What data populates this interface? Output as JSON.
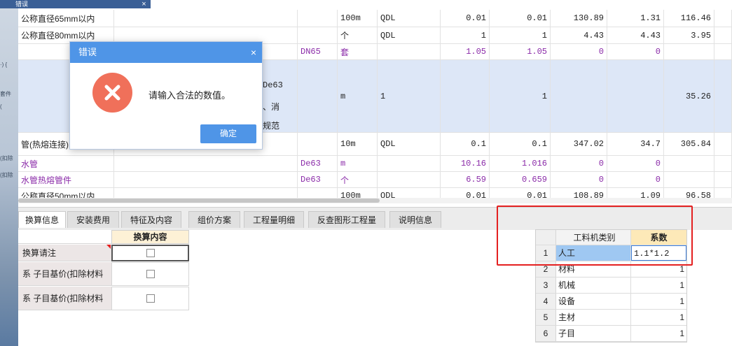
{
  "background_window": {
    "title": "错误",
    "close_glyph": "×"
  },
  "left_fragments": [
    "·) {",
    "套件",
    "( ",
    "(扣除",
    "(扣除"
  ],
  "grid_rows": [
    {
      "name": "公称直径65mm以内",
      "spec": "",
      "unit": "100m",
      "formula": "QDL",
      "qty1": "0.01",
      "qty2": "0.01",
      "p1": "130.89",
      "p2": "1.31",
      "p3": "116.46",
      "style": "normal"
    },
    {
      "name": "公称直径80mm以内",
      "spec": "",
      "unit": "个",
      "formula": "QDL",
      "qty1": "1",
      "qty2": "1",
      "p1": "4.43",
      "p2": "4.43",
      "p3": "3.95",
      "style": "normal"
    },
    {
      "name": "",
      "spec": "DN65",
      "unit": "套",
      "formula": "",
      "qty1": "1.05",
      "qty2": "1.05",
      "p1": "0",
      "p2": "0",
      "p3": "",
      "style": "purple"
    },
    {
      "name": "",
      "spec": "De63",
      "unit": "m",
      "formula": "1",
      "qty1": "",
      "qty2": "1",
      "p1": "",
      "p2": "",
      "p3": "35.26",
      "style": "selected",
      "extra1": "、消",
      "extra2": "规范"
    },
    {
      "name": "管(热熔连接) 公",
      "spec": "",
      "unit": "10m",
      "formula": "QDL",
      "qty1": "0.1",
      "qty2": "0.1",
      "p1": "347.02",
      "p2": "34.7",
      "p3": "305.84",
      "style": "normal"
    },
    {
      "name": "水管",
      "spec": "De63",
      "unit": "m",
      "formula": "",
      "qty1": "10.16",
      "qty2": "1.016",
      "p1": "0",
      "p2": "0",
      "p3": "",
      "style": "purple"
    },
    {
      "name": "水管热熔管件",
      "spec": "De63",
      "unit": "个",
      "formula": "",
      "qty1": "6.59",
      "qty2": "0.659",
      "p1": "0",
      "p2": "0",
      "p3": "",
      "style": "purple"
    },
    {
      "name": "公称直径50mm以内",
      "spec": "",
      "unit": "100m",
      "formula": "QDL",
      "qty1": "0.01",
      "qty2": "0.01",
      "p1": "108.89",
      "p2": "1.09",
      "p3": "96.58",
      "style": "normal"
    }
  ],
  "tabs": [
    "换算信息",
    "安装费用",
    "特征及内容",
    "组价方案",
    "工程量明细",
    "反查图形工程量",
    "说明信息"
  ],
  "conversion_panel": {
    "header": "换算内容",
    "rows": [
      "换算请注",
      "系 子目基价(扣除材料",
      "系 子目基价(扣除材料"
    ]
  },
  "coef_table": {
    "headers": [
      "工料机类别",
      "系数"
    ],
    "rows": [
      {
        "idx": "1",
        "type": "人工",
        "value": "1.1*1.2"
      },
      {
        "idx": "2",
        "type": "材料",
        "value": "1"
      },
      {
        "idx": "3",
        "type": "机械",
        "value": "1"
      },
      {
        "idx": "4",
        "type": "设备",
        "value": "1"
      },
      {
        "idx": "5",
        "type": "主材",
        "value": "1"
      },
      {
        "idx": "6",
        "type": "子目",
        "value": "1"
      }
    ]
  },
  "dialog": {
    "title": "错误",
    "close_glyph": "×",
    "message": "请输入合法的数值。",
    "ok_label": "确定",
    "icon": "error-x-icon"
  },
  "colors": {
    "dialog_blue": "#4f95e7",
    "error_red": "#f0705a",
    "highlight_red": "#e42020",
    "purple_text": "#8a2aa8"
  }
}
